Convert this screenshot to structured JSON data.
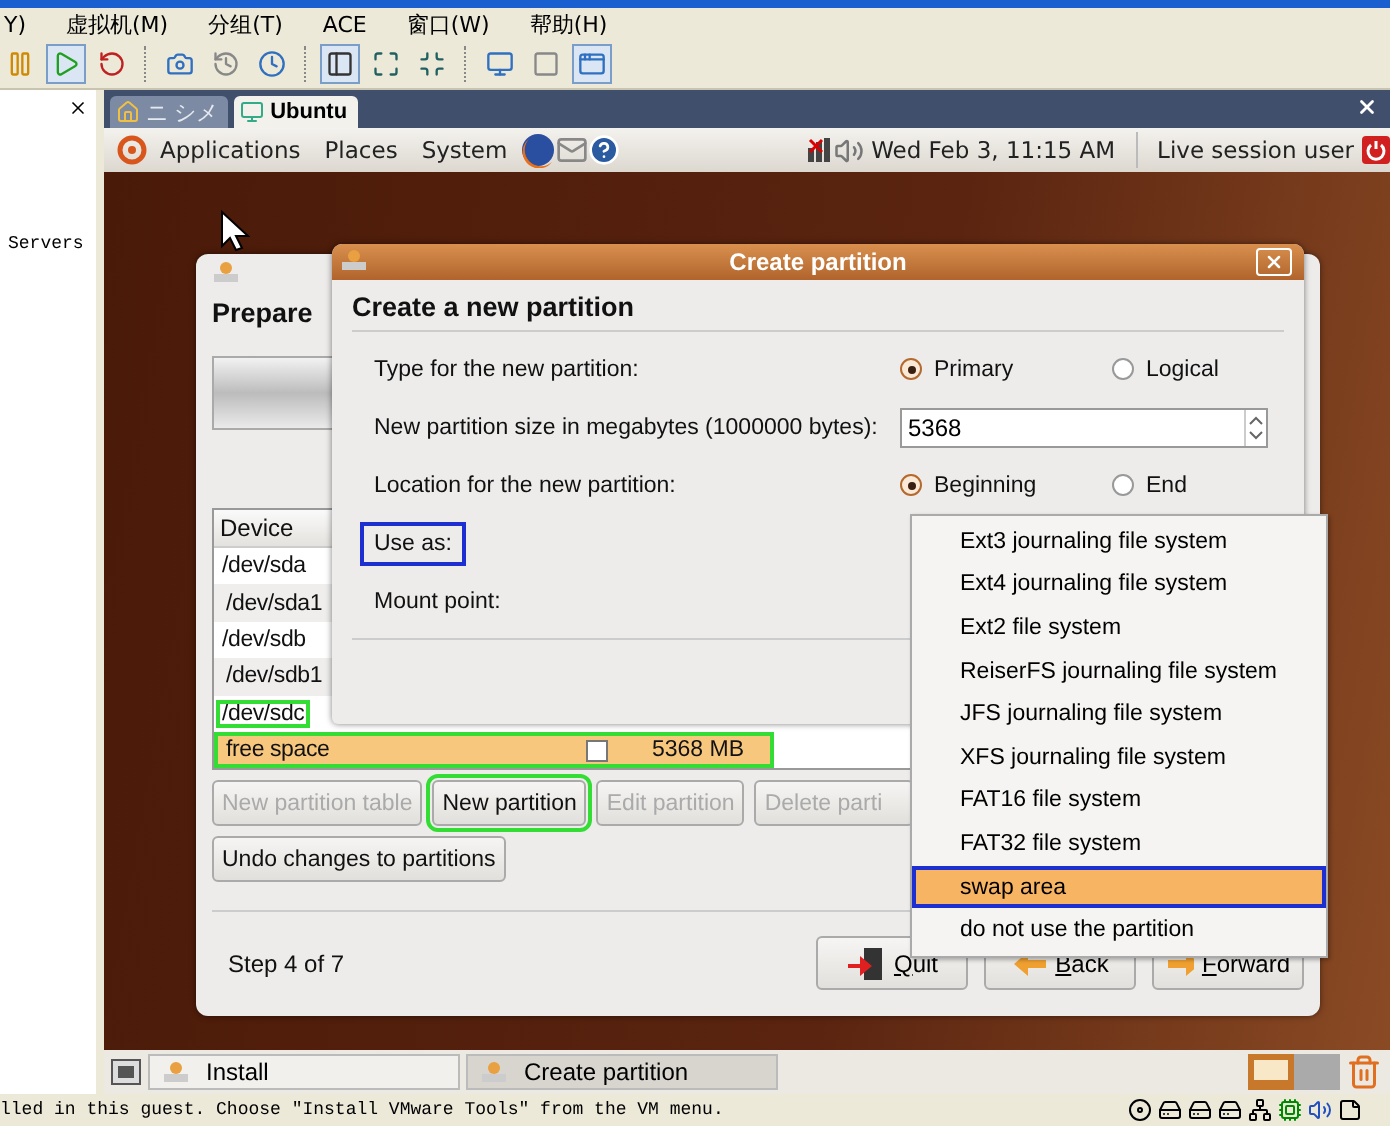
{
  "host_menu": [
    "Y)",
    "虚拟机(M)",
    "分组(T)",
    "ACE",
    "窗口(W)",
    "帮助(H)"
  ],
  "sidebar": {
    "items": [
      "Servers"
    ]
  },
  "vm_tabs": [
    {
      "label": "ニ シメ",
      "selected": false
    },
    {
      "label": "Ubuntu",
      "selected": true
    }
  ],
  "panel": {
    "menus": [
      "Applications",
      "Places",
      "System"
    ],
    "clock": "Wed Feb  3, 11:15 AM",
    "user": "Live session user"
  },
  "installer": {
    "title": "Prepare",
    "table": {
      "columns": [
        "Device"
      ],
      "rows": [
        {
          "device": "/dev/sda",
          "selected": false,
          "highlighted": false,
          "children": [
            {
              "device": "/dev/sda1",
              "selected": false,
              "highlighted": false
            }
          ]
        },
        {
          "device": "/dev/sdb",
          "selected": false,
          "highlighted": false,
          "children": [
            {
              "device": "/dev/sdb1",
              "selected": false,
              "highlighted": false
            }
          ]
        },
        {
          "device": "/dev/sdc",
          "selected": false,
          "highlighted": true,
          "children": [
            {
              "device": "free space",
              "selected": true,
              "highlighted": true,
              "checked": false,
              "size": "5368 MB"
            }
          ]
        }
      ]
    },
    "buttons": [
      {
        "label": "New partition table",
        "disabled": true,
        "highlighted": false
      },
      {
        "label": "New partition",
        "disabled": false,
        "highlighted": true
      },
      {
        "label": "Edit partition",
        "disabled": true,
        "highlighted": false
      },
      {
        "label": "Delete parti",
        "disabled": true,
        "highlighted": false
      }
    ],
    "undo": "Undo changes to partitions",
    "step": "Step 4 of 7",
    "nav": [
      {
        "label": "Quit",
        "kind": "quit"
      },
      {
        "label": "Back",
        "kind": "back"
      },
      {
        "label": "Forward",
        "kind": "forward"
      }
    ]
  },
  "dialog": {
    "title": "Create partition",
    "heading": "Create a new partition",
    "fields": [
      {
        "kind": "radio",
        "label": "Type for the new partition:",
        "highlighted": false,
        "options": [
          {
            "label": "Primary",
            "selected": true
          },
          {
            "label": "Logical",
            "selected": false
          }
        ]
      },
      {
        "kind": "spin",
        "label": "New partition size in megabytes (1000000 bytes):",
        "highlighted": false,
        "value": "5368"
      },
      {
        "kind": "radio",
        "label": "Location for the new partition:",
        "highlighted": false,
        "options": [
          {
            "label": "Beginning",
            "selected": true
          },
          {
            "label": "End",
            "selected": false
          }
        ]
      },
      {
        "kind": "combo",
        "label": "Use as:",
        "highlighted": true
      },
      {
        "kind": "text",
        "label": "Mount point:",
        "highlighted": false
      }
    ]
  },
  "menu": {
    "items": [
      {
        "label": "Ext3 journaling file system",
        "selected": false
      },
      {
        "label": "Ext4 journaling file system",
        "selected": false
      },
      {
        "label": "Ext2 file system",
        "selected": false
      },
      {
        "label": "ReiserFS journaling file system",
        "selected": false
      },
      {
        "label": "JFS journaling file system",
        "selected": false
      },
      {
        "label": "XFS journaling file system",
        "selected": false
      },
      {
        "label": "FAT16 file system",
        "selected": false
      },
      {
        "label": "FAT32 file system",
        "selected": false
      },
      {
        "label": "swap area",
        "selected": true
      },
      {
        "label": "do not use the partition",
        "selected": false
      }
    ]
  },
  "taskbar": [
    {
      "label": "Install",
      "selected": false
    },
    {
      "label": "Create partition",
      "selected": true
    }
  ],
  "status_bar": {
    "text": "lled in this guest. Choose \"Install VMware Tools\" from the VM menu."
  }
}
